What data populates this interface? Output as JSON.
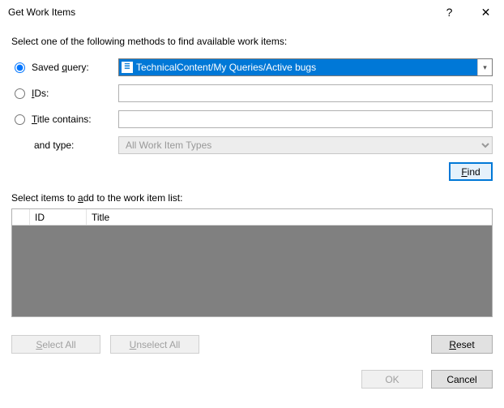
{
  "titlebar": {
    "title": "Get Work Items",
    "help": "?",
    "close": "✕"
  },
  "instruction": "Select one of the following methods to find available work items:",
  "method": {
    "saved_query": {
      "label_pre": "Saved ",
      "label_u": "q",
      "label_post": "uery:",
      "value": "TechnicalContent/My Queries/Active bugs",
      "selected": true
    },
    "ids": {
      "label_u": "I",
      "label_post": "Ds:",
      "value": ""
    },
    "title": {
      "label_u": "T",
      "label_post": "itle contains:",
      "value": ""
    },
    "type": {
      "label": "and type:",
      "value": "All Work Item Types"
    }
  },
  "find_label": {
    "u": "F",
    "post": "ind"
  },
  "select_label": {
    "pre": "Select items to ",
    "u": "a",
    "post": "dd to the work item list:"
  },
  "grid": {
    "col_id": "ID",
    "col_title": "Title",
    "rows": []
  },
  "buttons": {
    "select_all": {
      "u": "S",
      "post": "elect All"
    },
    "unselect_all": {
      "u": "U",
      "post": "nselect All"
    },
    "reset": {
      "u": "R",
      "post": "eset"
    },
    "ok": "OK",
    "cancel": "Cancel"
  }
}
